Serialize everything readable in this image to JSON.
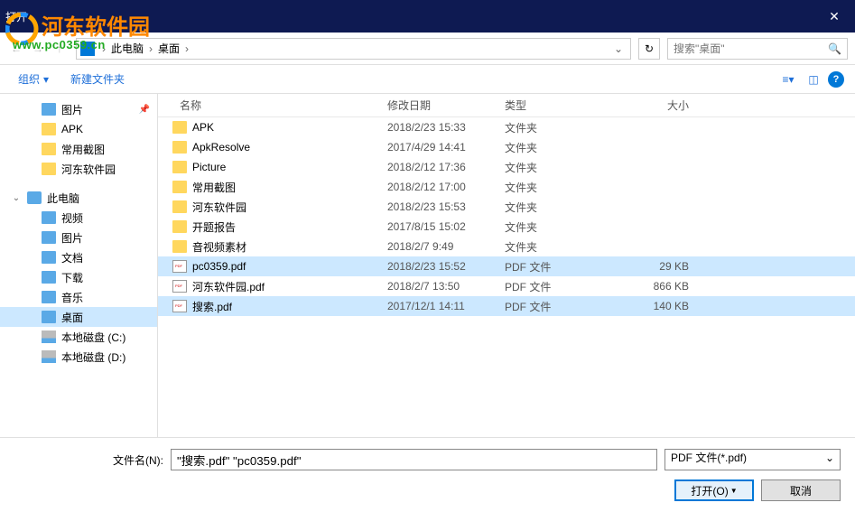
{
  "window": {
    "title": "打开",
    "close": "✕"
  },
  "watermark": {
    "text": "河东软件园",
    "url": "www.pc0359.cn"
  },
  "nav": {
    "breadcrumb": [
      "此电脑",
      "桌面"
    ],
    "search_placeholder": "搜索\"桌面\"",
    "refresh": "↻"
  },
  "toolbar": {
    "organize": "组织",
    "new_folder": "新建文件夹",
    "help": "?"
  },
  "sidebar": {
    "items": [
      {
        "label": "图片",
        "type": "folder-blue",
        "pin": true,
        "child": true
      },
      {
        "label": "APK",
        "type": "folder",
        "child": true
      },
      {
        "label": "常用截图",
        "type": "folder",
        "child": true
      },
      {
        "label": "河东软件园",
        "type": "folder",
        "child": true
      },
      {
        "spacer": true
      },
      {
        "label": "此电脑",
        "type": "computer",
        "expand": "⌄"
      },
      {
        "label": "视频",
        "type": "folder-blue",
        "child": true
      },
      {
        "label": "图片",
        "type": "folder-blue",
        "child": true
      },
      {
        "label": "文档",
        "type": "folder-blue",
        "child": true
      },
      {
        "label": "下载",
        "type": "folder-blue",
        "child": true
      },
      {
        "label": "音乐",
        "type": "folder-blue",
        "child": true
      },
      {
        "label": "桌面",
        "type": "folder-blue",
        "child": true,
        "selected": true
      },
      {
        "label": "本地磁盘 (C:)",
        "type": "drive",
        "child": true
      },
      {
        "label": "本地磁盘 (D:)",
        "type": "drive",
        "child": true
      }
    ]
  },
  "columns": {
    "name": "名称",
    "date": "修改日期",
    "type": "类型",
    "size": "大小"
  },
  "files": [
    {
      "name": "APK",
      "date": "2018/2/23 15:33",
      "type": "文件夹",
      "size": "",
      "icon": "folder"
    },
    {
      "name": "ApkResolve",
      "date": "2017/4/29 14:41",
      "type": "文件夹",
      "size": "",
      "icon": "folder"
    },
    {
      "name": "Picture",
      "date": "2018/2/12 17:36",
      "type": "文件夹",
      "size": "",
      "icon": "folder"
    },
    {
      "name": "常用截图",
      "date": "2018/2/12 17:00",
      "type": "文件夹",
      "size": "",
      "icon": "folder"
    },
    {
      "name": "河东软件园",
      "date": "2018/2/23 15:53",
      "type": "文件夹",
      "size": "",
      "icon": "folder"
    },
    {
      "name": "开题报告",
      "date": "2017/8/15 15:02",
      "type": "文件夹",
      "size": "",
      "icon": "folder"
    },
    {
      "name": "音视频素材",
      "date": "2018/2/7 9:49",
      "type": "文件夹",
      "size": "",
      "icon": "folder"
    },
    {
      "name": "pc0359.pdf",
      "date": "2018/2/23 15:52",
      "type": "PDF 文件",
      "size": "29 KB",
      "icon": "pdf",
      "selected": true
    },
    {
      "name": "河东软件园.pdf",
      "date": "2018/2/7 13:50",
      "type": "PDF 文件",
      "size": "866 KB",
      "icon": "pdf"
    },
    {
      "name": "搜索.pdf",
      "date": "2017/12/1 14:11",
      "type": "PDF 文件",
      "size": "140 KB",
      "icon": "pdf",
      "selected": true
    }
  ],
  "footer": {
    "filename_label": "文件名(N):",
    "filename_value": "\"搜索.pdf\" \"pc0359.pdf\"",
    "filetype": "PDF 文件(*.pdf)",
    "open": "打开(O)",
    "cancel": "取消"
  }
}
